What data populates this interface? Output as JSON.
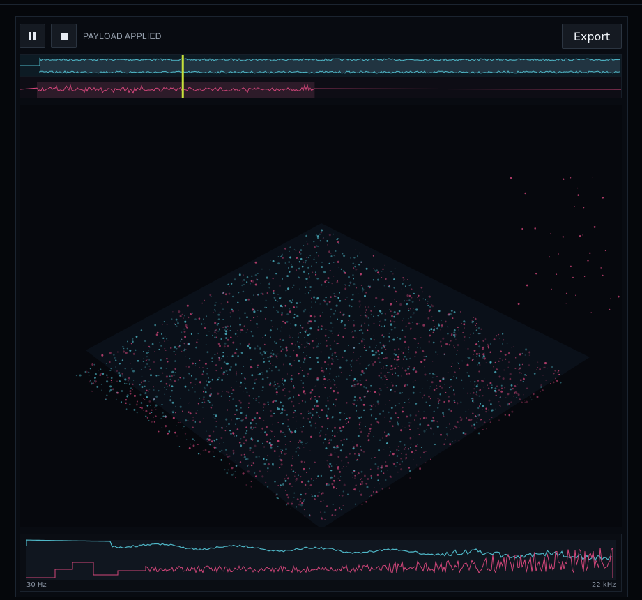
{
  "toolbar": {
    "pause_icon": "pause-icon",
    "stop_icon": "stop-icon",
    "status": "PAYLOAD APPLIED",
    "export_label": "Export"
  },
  "colors": {
    "accent_cyan": "#4fb8c8",
    "accent_pink": "#d2467a",
    "playhead": "#c6e03a",
    "background": "#06080d"
  },
  "timeline": {
    "playhead_fraction": 0.27,
    "track2_end_fraction": 0.49
  },
  "spectrum": {
    "min_label": "30 Hz",
    "max_label": "22 kHz"
  }
}
